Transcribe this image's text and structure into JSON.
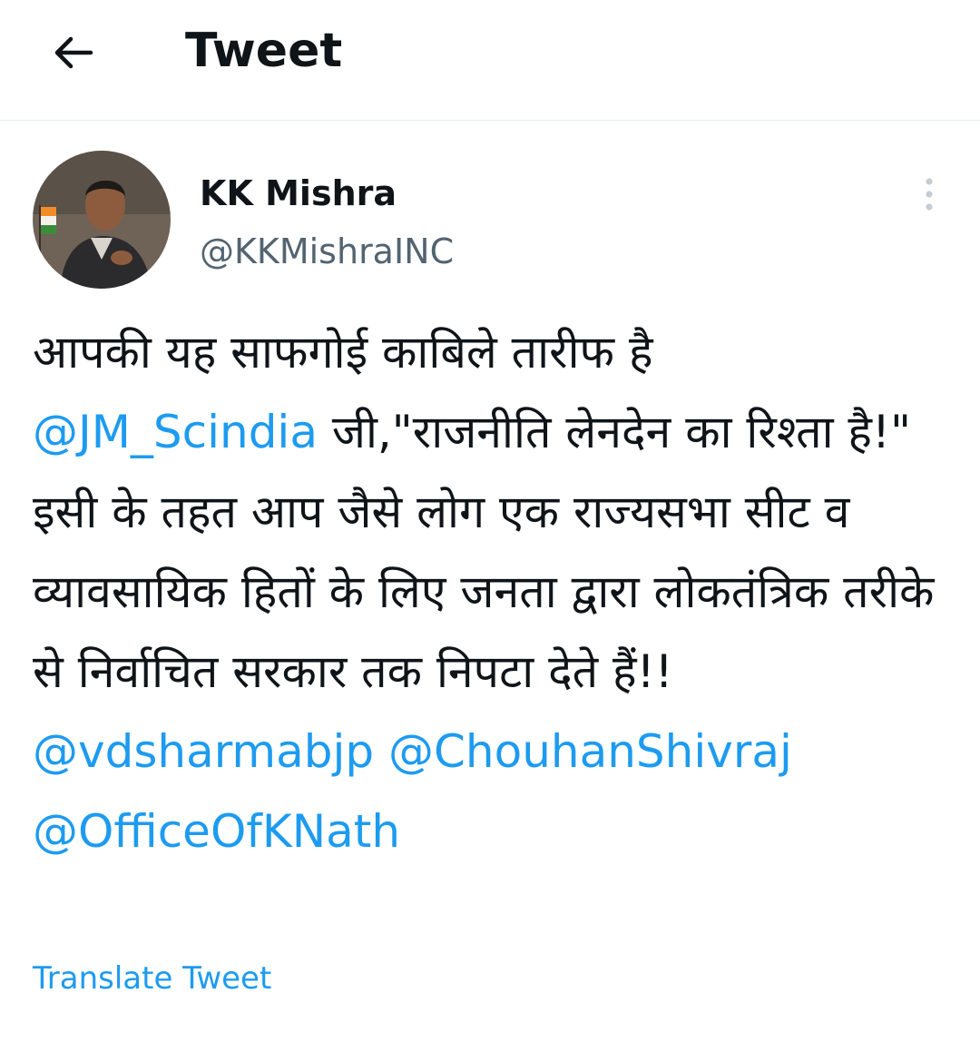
{
  "header": {
    "back_icon": "arrow-left-icon",
    "title": "Tweet"
  },
  "author": {
    "display_name": "KK Mishra",
    "handle": "@KKMishraINC",
    "avatar_icon": "user-avatar",
    "more_icon": "vertical-ellipsis-icon"
  },
  "tweet": {
    "text_part1": "आपकी यह साफगोई काबिले तारीफ है ",
    "mention1": "@JM_Scindia",
    "text_part2": " जी,\"राजनीति लेनदेन का रिश्ता है!\" इसी के तहत आप जैसे लोग एक राज्यसभा सीट व व्यावसायिक हितों के लिए जनता द्वारा लोकतंत्रिक तरीके से निर्वाचित सरकार तक निपटा देते हैं!! ",
    "mention2": "@vdsharmabjp",
    "mention3": "@ChouhanShivraj",
    "mention4": "@OfficeOfKNath"
  },
  "translate_label": "Translate Tweet",
  "colors": {
    "link": "#1d9bf0",
    "text": "#0f1419",
    "secondary": "#536471",
    "divider": "#e6ecf0"
  }
}
